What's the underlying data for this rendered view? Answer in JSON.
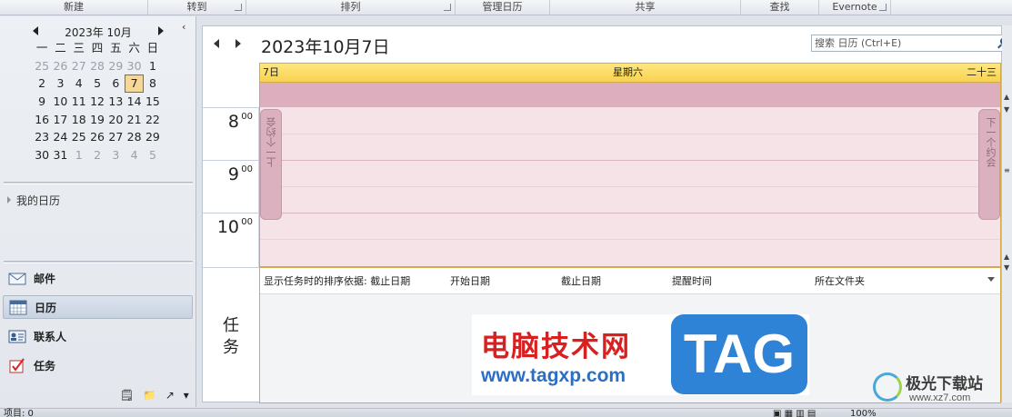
{
  "ribbon": {
    "groups": [
      {
        "label": "新建"
      },
      {
        "label": "转到"
      },
      {
        "label": "排列"
      },
      {
        "label": "管理日历"
      },
      {
        "label": "共享"
      },
      {
        "label": "查找"
      },
      {
        "label": "Evernote"
      }
    ]
  },
  "mini_calendar": {
    "month_label": "2023年 10月",
    "weekdays": [
      "一",
      "二",
      "三",
      "四",
      "五",
      "六",
      "日"
    ],
    "weeks": [
      [
        "25",
        "26",
        "27",
        "28",
        "29",
        "30",
        "1"
      ],
      [
        "2",
        "3",
        "4",
        "5",
        "6",
        "7",
        "8"
      ],
      [
        "9",
        "10",
        "11",
        "12",
        "13",
        "14",
        "15"
      ],
      [
        "16",
        "17",
        "18",
        "19",
        "20",
        "21",
        "22"
      ],
      [
        "23",
        "24",
        "25",
        "26",
        "27",
        "28",
        "29"
      ],
      [
        "30",
        "31",
        "1",
        "2",
        "3",
        "4",
        "5"
      ]
    ],
    "selected": "7"
  },
  "my_calendars": {
    "label": "我的日历"
  },
  "nav_items": [
    {
      "label": "邮件",
      "icon": "mail-icon"
    },
    {
      "label": "日历",
      "icon": "calendar-icon",
      "active": true
    },
    {
      "label": "联系人",
      "icon": "contacts-icon"
    },
    {
      "label": "任务",
      "icon": "tasks-icon"
    }
  ],
  "main": {
    "date_title": "2023年10月7日",
    "search_placeholder": "搜索 日历 (Ctrl+E)",
    "day_header": {
      "day_number": "7日",
      "weekday": "星期六",
      "lunar": "二十三"
    },
    "hours": [
      {
        "h": "8",
        "m": "00"
      },
      {
        "h": "9",
        "m": "00"
      },
      {
        "h": "10",
        "m": "00"
      }
    ],
    "prev_appointment": "上一个约会",
    "next_appointment": "下一个约会",
    "tasks_label": "任务",
    "task_columns": [
      {
        "label": "显示任务时的排序依据: 截止日期"
      },
      {
        "label": "开始日期"
      },
      {
        "label": "截止日期"
      },
      {
        "label": "提醒时间"
      },
      {
        "label": "所在文件夹"
      }
    ]
  },
  "watermark": {
    "cn": "电脑技术网",
    "url": "www.tagxp.com",
    "tag": "TAG"
  },
  "corner_watermark": {
    "cn": "极光下载站",
    "url": "www.xz7.com"
  },
  "status_bar": {
    "items": "项目: 0",
    "zoom": "100%"
  },
  "colors": {
    "header_yellow": "#f8d350",
    "allday_pink": "#ddaebe",
    "day_pink": "#f5e3e8",
    "selected_day": "#f5d79a",
    "brand_red": "#d82020",
    "brand_blue": "#2f83d6"
  }
}
